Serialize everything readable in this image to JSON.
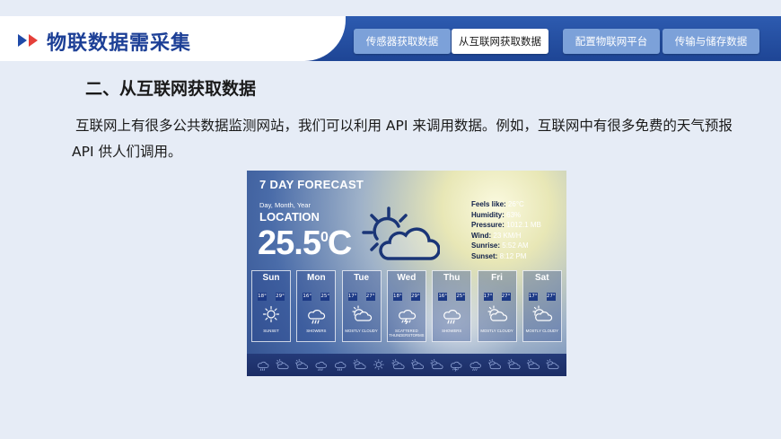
{
  "header": {
    "app_title": "物联数据需采集",
    "tabs": [
      {
        "label": "传感器获取数据",
        "active": false
      },
      {
        "label": "从互联网获取数据",
        "active": true
      },
      {
        "label": "配置物联网平台",
        "active": false
      },
      {
        "label": "传输与储存数据",
        "active": false
      }
    ]
  },
  "section": {
    "title": "二、从互联网获取数据",
    "paragraph": "互联网上有很多公共数据监测网站，我们可以利用 API 来调用数据。例如，互联网中有很多免费的天气预报 API 供人们调用。"
  },
  "weather": {
    "title": "7 DAY FORECAST",
    "date_line": "Day, Month, Year",
    "location": "LOCATION",
    "temp_value": "25.5",
    "temp_unit": "C",
    "temp_deg": "0",
    "details": [
      {
        "label": "Feels like:",
        "value": "26°C"
      },
      {
        "label": "Humidity:",
        "value": "63%"
      },
      {
        "label": "Pressure:",
        "value": "1012.1 MB"
      },
      {
        "label": "Wind:",
        "value": "23 KM/H"
      },
      {
        "label": "Sunrise:",
        "value": "5:52 AM"
      },
      {
        "label": "Sunset:",
        "value": "8:12 PM"
      }
    ],
    "days": [
      {
        "name": "Sun",
        "low": "18°",
        "high": "29°",
        "condition": "SUNSET",
        "icon": "sun-icon"
      },
      {
        "name": "Mon",
        "low": "16°",
        "high": "25°",
        "condition": "SHOWERS",
        "icon": "showers-icon"
      },
      {
        "name": "Tue",
        "low": "17°",
        "high": "27°",
        "condition": "MOSTLY CLOUDY",
        "icon": "mostly-cloudy-icon"
      },
      {
        "name": "Wed",
        "low": "18°",
        "high": "29°",
        "condition": "SCATTERED THUNDERSTORMS",
        "icon": "thunderstorm-icon"
      },
      {
        "name": "Thu",
        "low": "16°",
        "high": "25°",
        "condition": "SHOWERS",
        "icon": "showers-icon"
      },
      {
        "name": "Fri",
        "low": "17°",
        "high": "27°",
        "condition": "MOSTLY CLOUDY",
        "icon": "mostly-cloudy-icon"
      },
      {
        "name": "Sat",
        "low": "17°",
        "high": "27°",
        "condition": "MOSTLY CLOUDY",
        "icon": "mostly-cloudy-icon"
      }
    ],
    "icon_strip": [
      "cloud-rain-icon",
      "moon-cloud-icon",
      "cloud-icon",
      "cloud-rain-icon",
      "cloud-rain-icon",
      "sun-cloud-icon",
      "sun-icon",
      "sun-cloud-icon",
      "moon-cloud-icon",
      "cloud-icon",
      "lightning-icon",
      "cloud-rain-icon",
      "sun-cloud-icon",
      "snowflake-icon",
      "umbrella-icon",
      "moon-icon"
    ]
  },
  "colors": {
    "brand_blue": "#1e4595",
    "accent_red": "#e5403a",
    "tab_inactive": "#7ca1d9"
  }
}
